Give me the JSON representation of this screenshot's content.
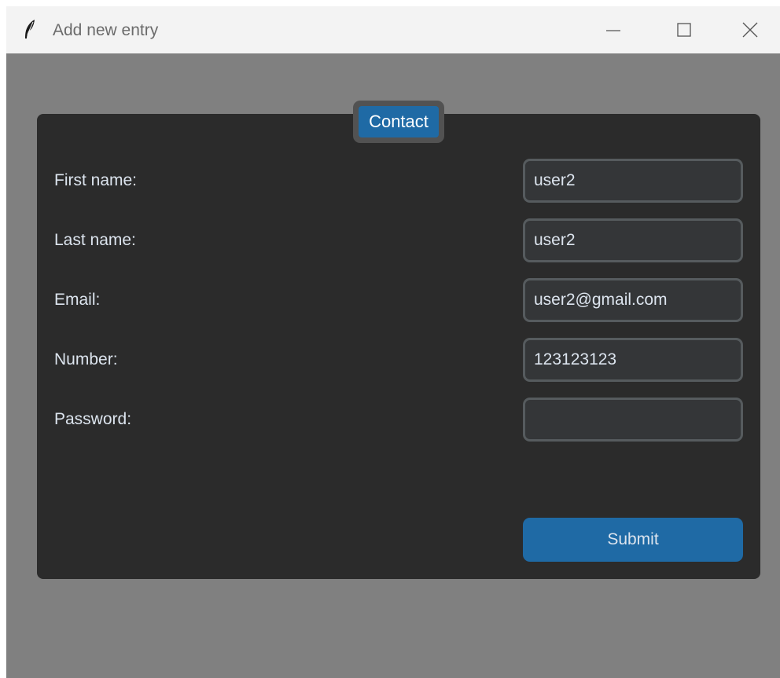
{
  "window": {
    "title": "Add new entry",
    "icon": "feather-icon",
    "controls": [
      "minimize-icon",
      "maximize-icon",
      "close-icon"
    ]
  },
  "tab": {
    "label": "Contact"
  },
  "form": {
    "fields": [
      {
        "label": "First name:",
        "value": "user2"
      },
      {
        "label": "Last name:",
        "value": "user2"
      },
      {
        "label": "Email:",
        "value": "user2@gmail.com"
      },
      {
        "label": "Number:",
        "value": "123123123"
      },
      {
        "label": "Password:",
        "value": ""
      }
    ],
    "submit_label": "Submit"
  },
  "colors": {
    "window_background": "#808080",
    "frame_background": "#2b2b2b",
    "accent": "#1f6aa5",
    "input_background": "#343638",
    "input_border": "#565b5e",
    "text": "#dce4ee"
  }
}
